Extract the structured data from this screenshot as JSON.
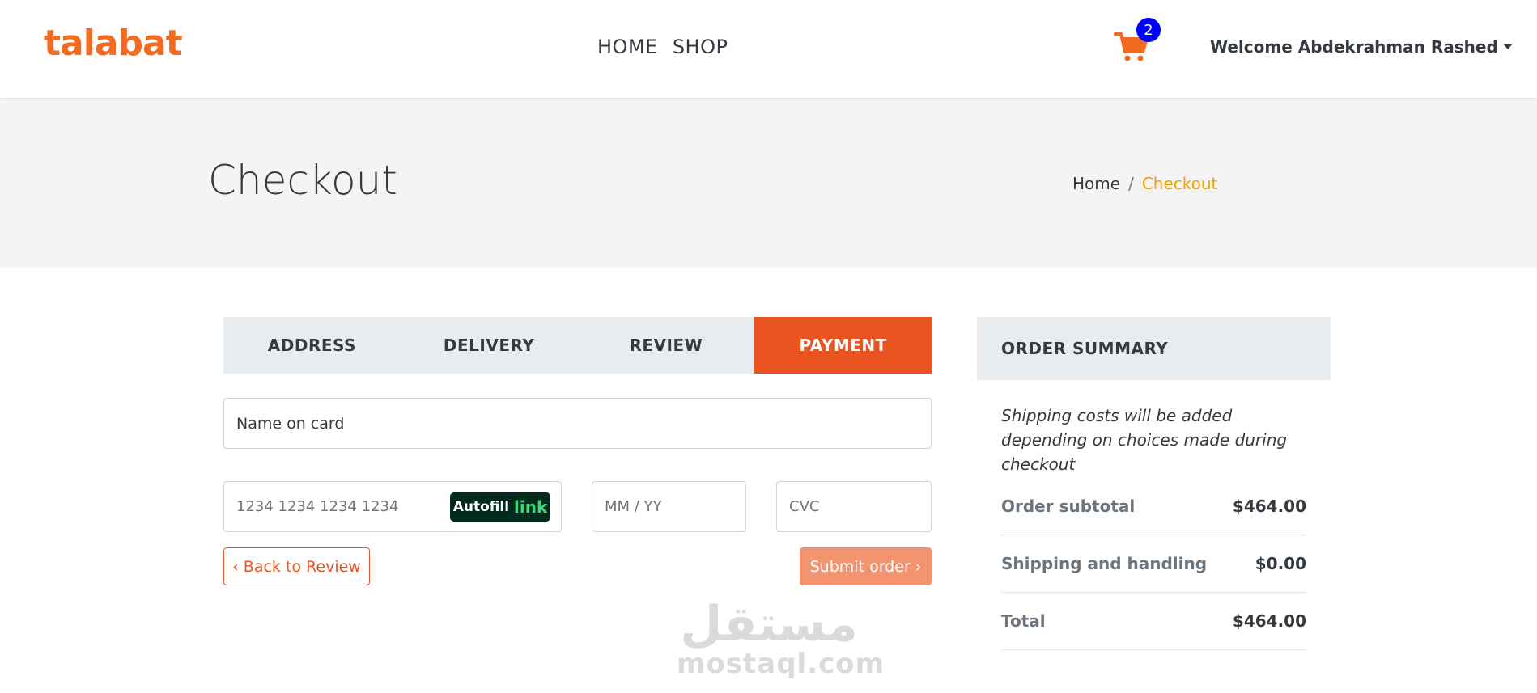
{
  "header": {
    "logo": "talabat",
    "nav": [
      {
        "label": "HOME"
      },
      {
        "label": "SHOP"
      }
    ],
    "cart_count": "2",
    "welcome": "Welcome Abdekrahman Rashed"
  },
  "hero": {
    "title": "Checkout",
    "breadcrumb": {
      "home": "Home",
      "separator": "/",
      "current": "Checkout"
    }
  },
  "steps": [
    {
      "label": "ADDRESS"
    },
    {
      "label": "DELIVERY"
    },
    {
      "label": "REVIEW"
    },
    {
      "label": "PAYMENT",
      "active": true
    }
  ],
  "payment": {
    "name_placeholder": "Name on card",
    "card_placeholder": "1234 1234 1234 1234",
    "autofill_label": "Autofill",
    "link_label": "link",
    "expiry_placeholder": "MM / YY",
    "cvc_placeholder": "CVC",
    "back_label": "‹ Back to Review",
    "submit_label": "Submit order ›"
  },
  "summary": {
    "title": "ORDER SUMMARY",
    "note": "Shipping costs will be added depending on choices made during checkout",
    "rows": [
      {
        "label": "Order subtotal",
        "value": "$464.00"
      },
      {
        "label": "Shipping and handling",
        "value": "$0.00"
      },
      {
        "label": "Total",
        "value": "$464.00"
      }
    ]
  },
  "watermark": {
    "arabic": "مستقل",
    "latin": "mostaql.com"
  },
  "colors": {
    "brand": "#f26b21",
    "accent": "#e95420",
    "breadcrumb_active": "#f4a100",
    "badge": "#0000ff"
  }
}
